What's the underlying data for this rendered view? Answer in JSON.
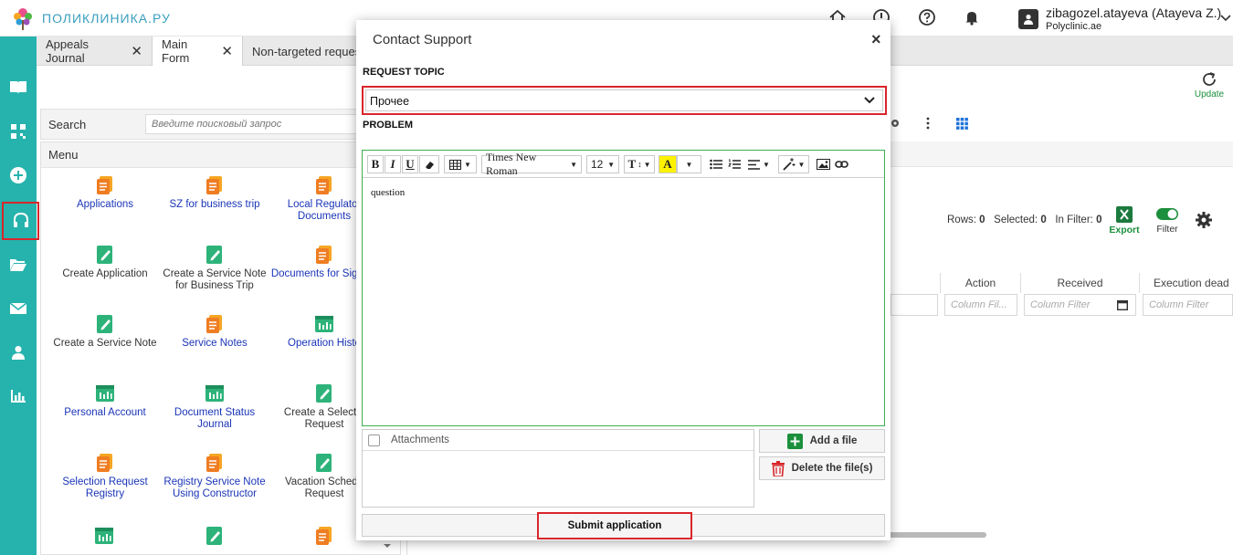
{
  "app": {
    "logo_text": "ПОЛИКЛИНИКА.РУ",
    "user_name": "zibagozel.atayeva (Atayeva Z.)",
    "user_org": "Polyclinic.ae"
  },
  "tabs": [
    {
      "label": "Appeals Journal"
    },
    {
      "label": "Main Form"
    },
    {
      "label": "Non-targeted reques"
    }
  ],
  "toolbar": {
    "update_label": "Update"
  },
  "search": {
    "label": "Search",
    "placeholder": "Введите поисковый запрос"
  },
  "menu": {
    "title": "Menu",
    "items": [
      {
        "label": "Applications",
        "icon": "folder-doc-icon",
        "color": "blue"
      },
      {
        "label": "SZ for business trip",
        "icon": "folder-doc-icon",
        "color": "blue"
      },
      {
        "label": "Local Regulator Documents",
        "icon": "folder-doc-icon",
        "color": "blue"
      },
      {
        "label": "Create Application",
        "icon": "edit-doc-icon",
        "color": "dark"
      },
      {
        "label": "Create a Service Note for Business Trip",
        "icon": "edit-doc-icon",
        "color": "dark"
      },
      {
        "label": "Documents for Signing",
        "icon": "folder-doc-icon",
        "color": "blue"
      },
      {
        "label": "Create a Service Note",
        "icon": "edit-doc-icon",
        "color": "dark"
      },
      {
        "label": "Service Notes",
        "icon": "folder-doc-icon",
        "color": "blue"
      },
      {
        "label": "Operation Histo",
        "icon": "report-icon",
        "color": "blue"
      },
      {
        "label": "Personal Account",
        "icon": "report-icon",
        "color": "blue"
      },
      {
        "label": "Document Status Journal",
        "icon": "report-icon",
        "color": "blue"
      },
      {
        "label": "Create a Selectio Request",
        "icon": "edit-doc-icon",
        "color": "dark"
      },
      {
        "label": "Selection Request Registry",
        "icon": "folder-doc-icon",
        "color": "blue"
      },
      {
        "label": "Registry Service Note Using Constructor",
        "icon": "folder-doc-icon",
        "color": "blue"
      },
      {
        "label": "Vacation Schedu Request",
        "icon": "edit-doc-icon",
        "color": "dark"
      }
    ]
  },
  "grid": {
    "rows_label": "Rows:",
    "rows_value": "0",
    "selected_label": "Selected:",
    "selected_value": "0",
    "infilter_label": "In Filter:",
    "infilter_value": "0",
    "export_label": "Export",
    "filter_label": "Filter",
    "columns": [
      {
        "label": "Action",
        "filter_placeholder": "Column Fil..."
      },
      {
        "label": "Received",
        "filter_placeholder": "Column Filter"
      },
      {
        "label": "Execution dead",
        "filter_placeholder": "Column Filter"
      }
    ]
  },
  "modal": {
    "title": "Contact Support",
    "close_symbol": "×",
    "topic_label": "REQUEST TOPIC",
    "topic_value": "Прочее",
    "problem_label": "PROBLEM",
    "editor": {
      "bold": "B",
      "italic": "I",
      "underline": "U",
      "font_family": "Times New Roman",
      "font_size": "12",
      "text_size_glyph": "T",
      "highlight_glyph": "A",
      "content": "question"
    },
    "attachments_label": "Attachments",
    "add_file_label": "Add a file",
    "delete_files_label": "Delete the file(s)",
    "submit_label": "Submit application"
  },
  "colors": {
    "sidebar": "#26b3ad",
    "highlight": "#d9262b",
    "link": "#1a35b8",
    "accent_green": "#1c8f3c",
    "editor_border": "#3fae4f"
  }
}
